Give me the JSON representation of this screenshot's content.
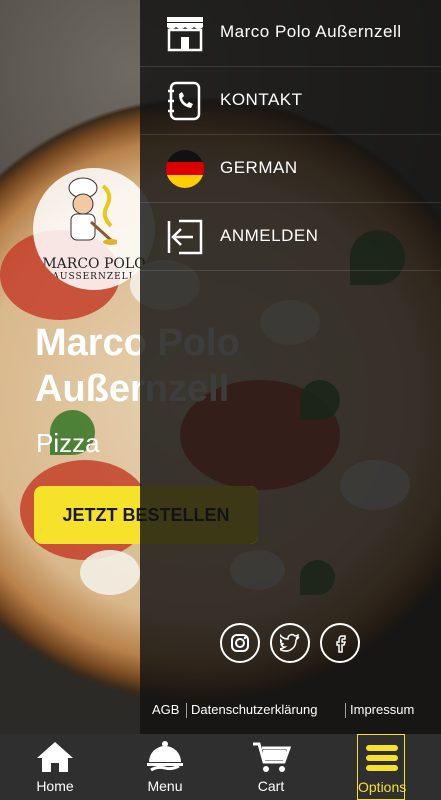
{
  "hero": {
    "title_line1": "Marco Polo",
    "title_line2": "Außernzell",
    "subtitle": "Pizza",
    "order_button": "JETZT BESTELLEN"
  },
  "logo": {
    "name_line1": "MARCO POLO",
    "name_line2": "AUSSERNZELL"
  },
  "drawer": {
    "items": [
      {
        "label": "Marco Polo Außernzell",
        "icon": "store-icon"
      },
      {
        "label": "KONTAKT",
        "icon": "phone-book-icon"
      },
      {
        "label": "GERMAN",
        "icon": "german-flag-icon"
      },
      {
        "label": "ANMELDEN",
        "icon": "login-icon"
      }
    ],
    "social": [
      "instagram-icon",
      "twitter-icon",
      "facebook-icon"
    ],
    "legal": {
      "agb": "AGB",
      "privacy": "Datenschutzerklärung",
      "imprint": "Impressum"
    }
  },
  "bottom_nav": {
    "tabs": [
      {
        "label": "Home",
        "icon": "home-icon"
      },
      {
        "label": "Menu",
        "icon": "cloche-icon"
      },
      {
        "label": "Cart",
        "icon": "cart-icon"
      },
      {
        "label": "Options",
        "icon": "hamburger-icon"
      }
    ],
    "active": "Options"
  },
  "colors": {
    "accent": "#f6e22b",
    "nav_bg": "#2f2f2f",
    "drawer_bg": "#121212"
  }
}
